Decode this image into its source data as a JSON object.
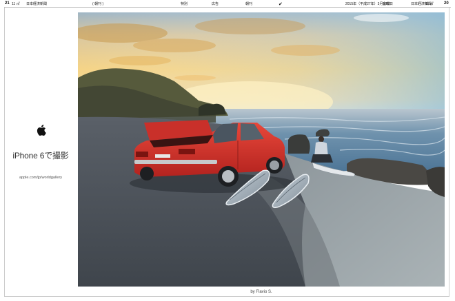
{
  "header": {
    "page_left": "21",
    "left_date": "11 ㎡",
    "left_label": "日本経済新聞",
    "left_small": "( 朝刊 )",
    "center_1": "特別",
    "center_2": "広告",
    "center_3": "朝刊",
    "center_mark": "✔",
    "right_date": "2015年（平成27年）3月13日",
    "right_day": "金曜日",
    "right_paper": "日本経済新聞",
    "right_edition": "11 ㎡",
    "page_right": "20"
  },
  "ad": {
    "logo": "apple-logo-icon",
    "tagline": "iPhone 6で撮影",
    "url": "apple.com/jp/worldgallery"
  },
  "photo": {
    "subject": "red-car-surfboards-beach-sunset",
    "credit": "by Flavio S."
  },
  "colors": {
    "car_red": "#d8302b",
    "sky_gold": "#f3c97a",
    "sea_blue": "#5d86a8",
    "ground_gray": "#4a4f55"
  }
}
